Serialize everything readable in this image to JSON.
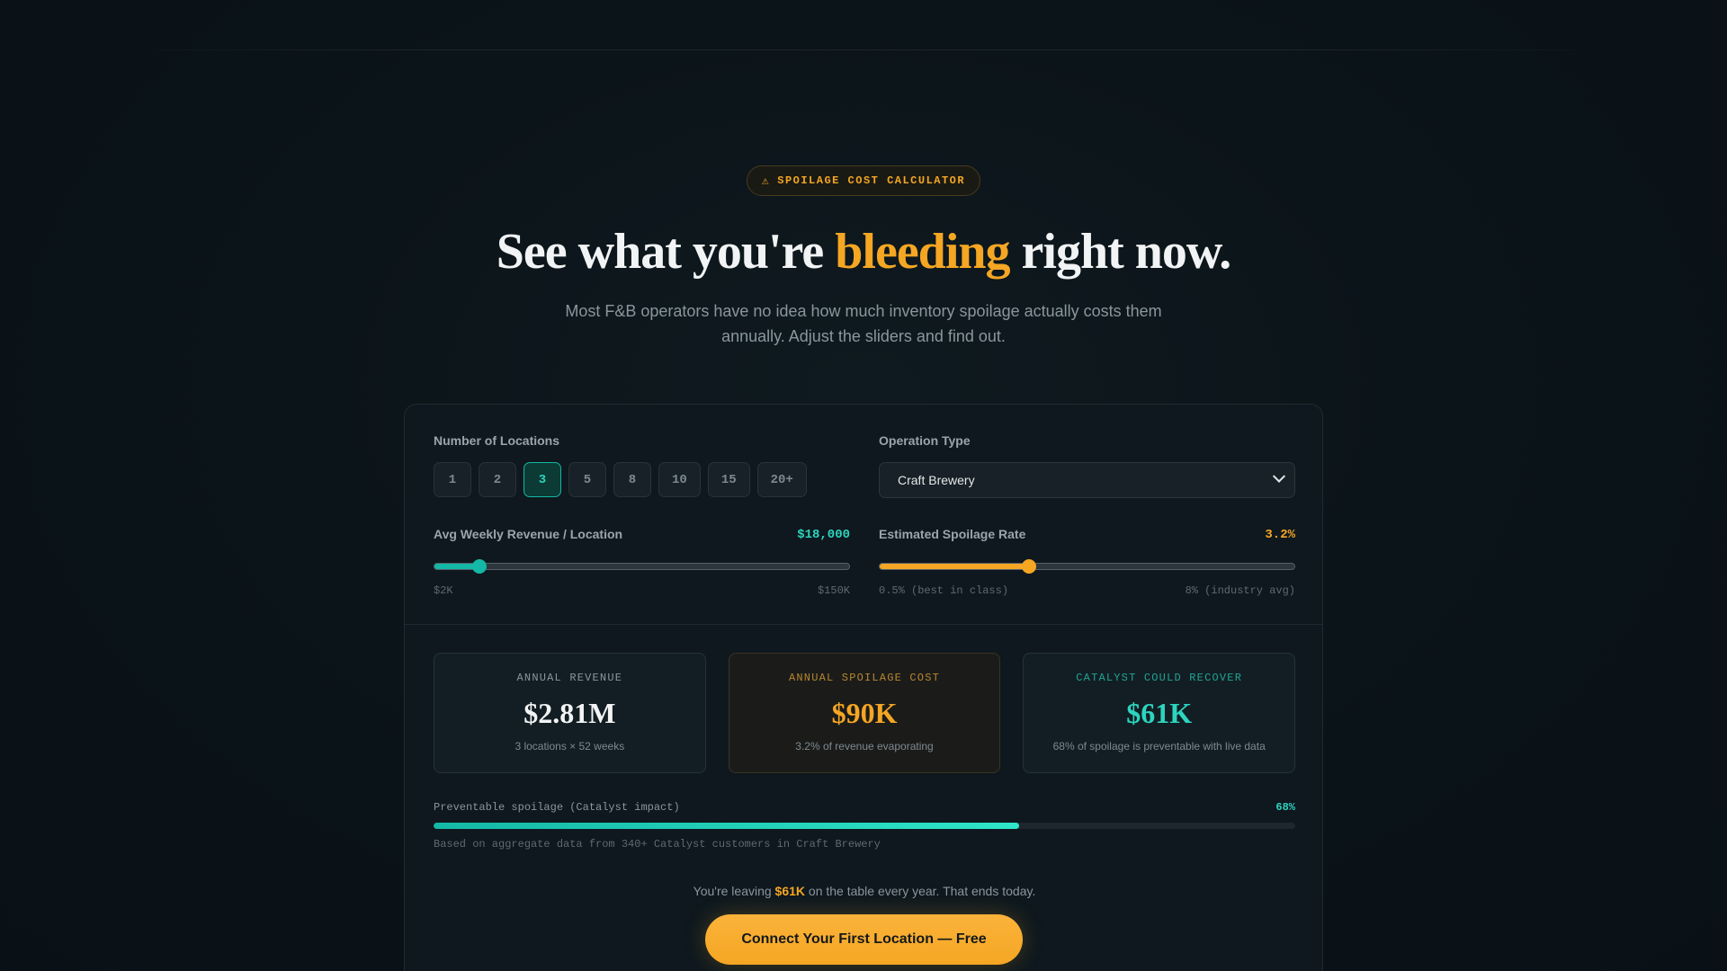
{
  "hero": {
    "badge_icon": "warning-icon",
    "badge_glyph": "⚠",
    "badge_text": "SPOILAGE COST CALCULATOR",
    "headline_pre": "See what you're ",
    "headline_accent": "bleeding",
    "headline_post": " right now.",
    "subtitle": "Most F&B operators have no idea how much inventory spoilage actually costs them annually. Adjust the sliders and find out."
  },
  "controls": {
    "locations": {
      "label": "Number of Locations",
      "options": [
        "1",
        "2",
        "3",
        "5",
        "8",
        "10",
        "15",
        "20+"
      ],
      "selected": "3"
    },
    "operation_type": {
      "label": "Operation Type",
      "value": "Craft Brewery"
    },
    "revenue_slider": {
      "label": "Avg Weekly Revenue / Location",
      "value_text": "$18,000",
      "min_label": "$2K",
      "max_label": "$150K",
      "fraction": 0.108
    },
    "spoilage_slider": {
      "label": "Estimated Spoilage Rate",
      "value_text": "3.2%",
      "min_label": "0.5% (best in class)",
      "max_label": "8% (industry avg)",
      "fraction": 0.36
    }
  },
  "stats": [
    {
      "label": "ANNUAL REVENUE",
      "value": "$2.81M",
      "note": "3 locations × 52 weeks"
    },
    {
      "label": "ANNUAL SPOILAGE COST",
      "value": "$90K",
      "note": "3.2% of revenue evaporating"
    },
    {
      "label": "CATALYST COULD RECOVER",
      "value": "$61K",
      "note": "68% of spoilage is preventable with live data"
    }
  ],
  "impact": {
    "label": "Preventable spoilage (Catalyst impact)",
    "percent_text": "68%",
    "fraction": 0.68,
    "note": "Based on aggregate data from 340+ Catalyst customers in Craft Brewery"
  },
  "cta": {
    "text_pre": "You're leaving ",
    "text_amount": "$61K",
    "text_post": " on the table every year. That ends today.",
    "button_label": "Connect Your First Location — Free"
  },
  "colors": {
    "accent_teal": "#2dd4bf",
    "accent_amber": "#f5a623",
    "background": "#0b1419"
  }
}
